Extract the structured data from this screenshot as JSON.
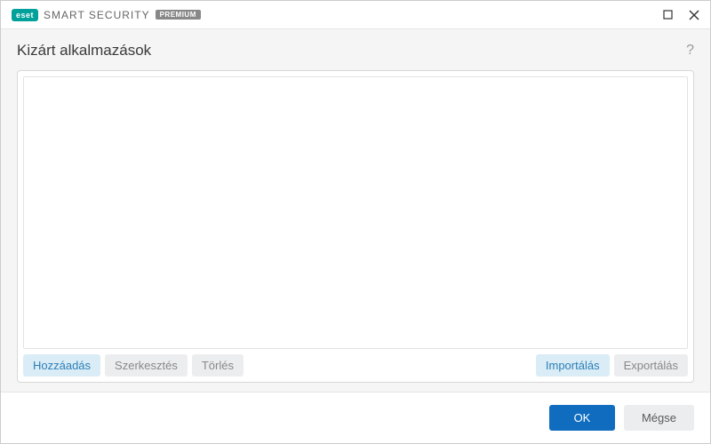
{
  "product": {
    "brand": "eset",
    "name": "SMART SECURITY",
    "edition": "PREMIUM"
  },
  "page": {
    "title": "Kizárt alkalmazások"
  },
  "actions": {
    "add": "Hozzáadás",
    "edit": "Szerkesztés",
    "delete": "Törlés",
    "import": "Importálás",
    "export": "Exportálás"
  },
  "footer": {
    "ok": "OK",
    "cancel": "Mégse"
  }
}
